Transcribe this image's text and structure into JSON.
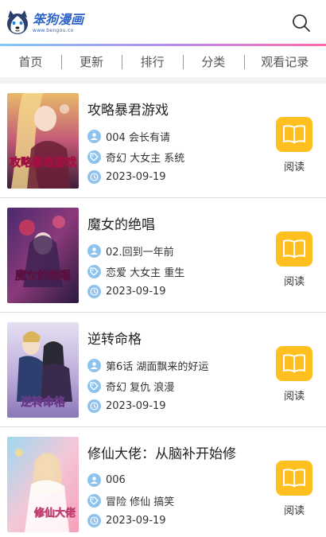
{
  "header": {
    "logo_title": "笨狗漫画",
    "logo_url": "www.bengou.co",
    "search_icon": "search-icon"
  },
  "nav": {
    "items": [
      {
        "label": "首页"
      },
      {
        "label": "更新"
      },
      {
        "label": "排行"
      },
      {
        "label": "分类"
      },
      {
        "label": "观看记录"
      }
    ]
  },
  "colors": {
    "accent_read": "#ffbf1f",
    "info_icon": "#8fc3ee",
    "logo_blue": "#2e64c8"
  },
  "comics": [
    {
      "title": "攻略暴君游戏",
      "chapter": "004 会长有请",
      "tags": "奇幻 大女主 系统",
      "date": "2023-09-19",
      "read_label": "阅读",
      "cover_text": "攻略暴君游戏"
    },
    {
      "title": "魔女的绝唱",
      "chapter": "02.回到一年前",
      "tags": "恋爱 大女主 重生",
      "date": "2023-09-19",
      "read_label": "阅读",
      "cover_text": "魔女的绝唱"
    },
    {
      "title": "逆转命格",
      "chapter": "第6话 湖面飘来的好运",
      "tags": "奇幻 复仇 浪漫",
      "date": "2023-09-19",
      "read_label": "阅读",
      "cover_text": "逆转命格"
    },
    {
      "title": "修仙大佬：从脑补开始修",
      "chapter": "006",
      "tags": "冒险 修仙 搞笑",
      "date": "2023-09-19",
      "read_label": "阅读",
      "cover_text": "修仙大佬"
    }
  ]
}
